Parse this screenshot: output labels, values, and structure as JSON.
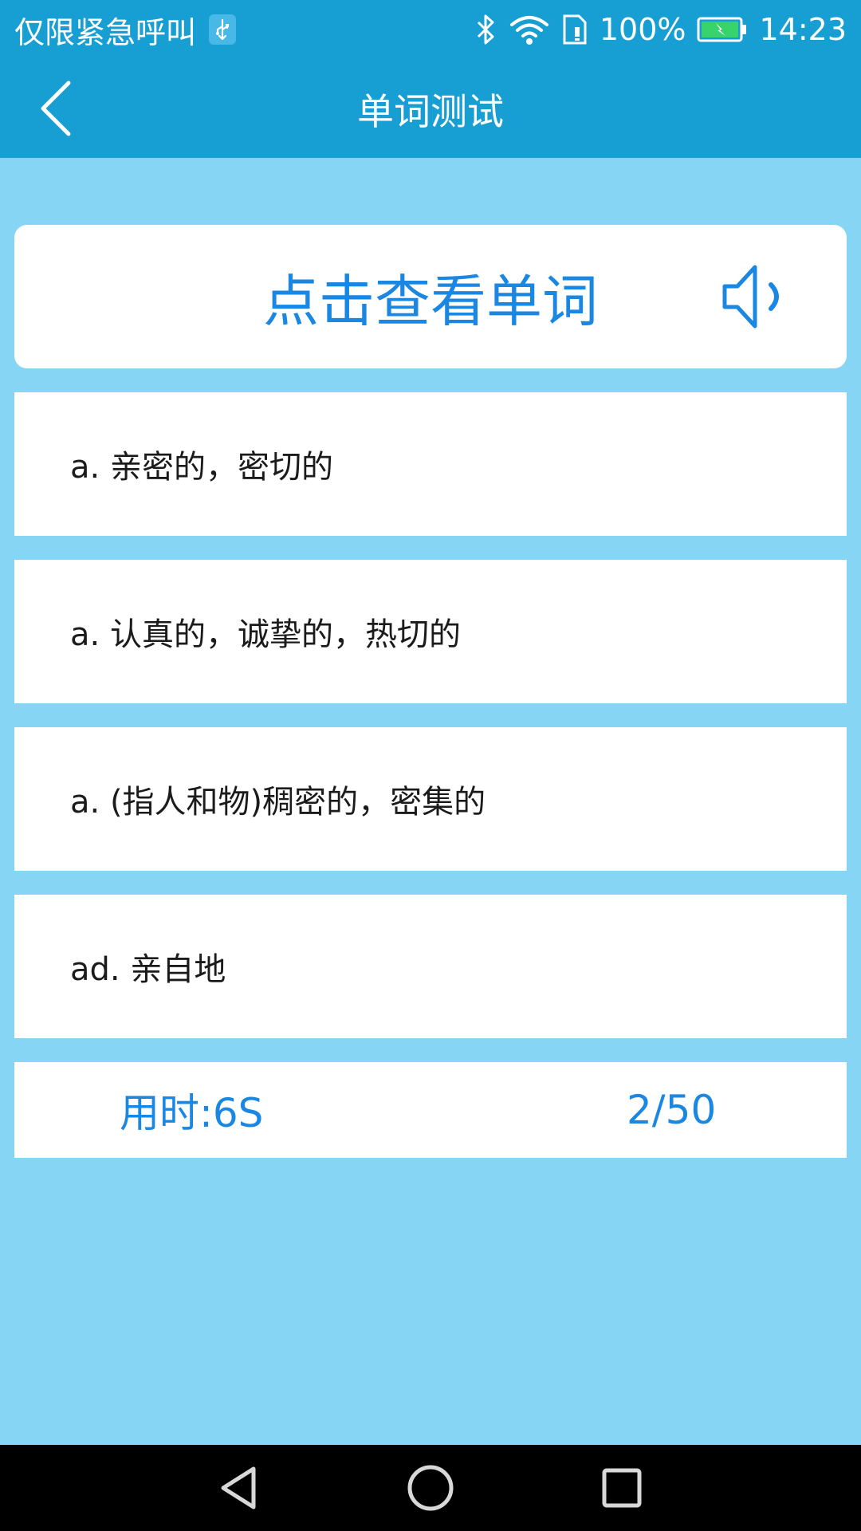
{
  "status_bar": {
    "carrier_text": "仅限紧急呼叫",
    "battery_percent": "100%",
    "time": "14:23",
    "icons": [
      "usb-icon",
      "bluetooth-icon",
      "wifi-icon",
      "sim-icon",
      "battery-icon"
    ]
  },
  "header": {
    "title": "单词测试",
    "back_icon": "chevron-left-icon"
  },
  "word_card": {
    "prompt": "点击查看单词",
    "speaker_icon": "speaker-icon"
  },
  "options": [
    {
      "text": "a. 亲密的，密切的"
    },
    {
      "text": "a. 认真的，诚挚的，热切的"
    },
    {
      "text": "a. (指人和物)稠密的，密集的"
    },
    {
      "text": "ad. 亲自地"
    }
  ],
  "footer": {
    "time_used": "用时:6S",
    "progress": "2/50"
  },
  "nav_bar": {
    "icons": [
      "nav-back-icon",
      "nav-home-icon",
      "nav-recent-icon"
    ]
  },
  "colors": {
    "header_bg": "#179ed2",
    "page_bg": "#86d5f4",
    "accent_text": "#1a87e3",
    "card_bg": "#ffffff",
    "nav_bg": "#000000"
  }
}
